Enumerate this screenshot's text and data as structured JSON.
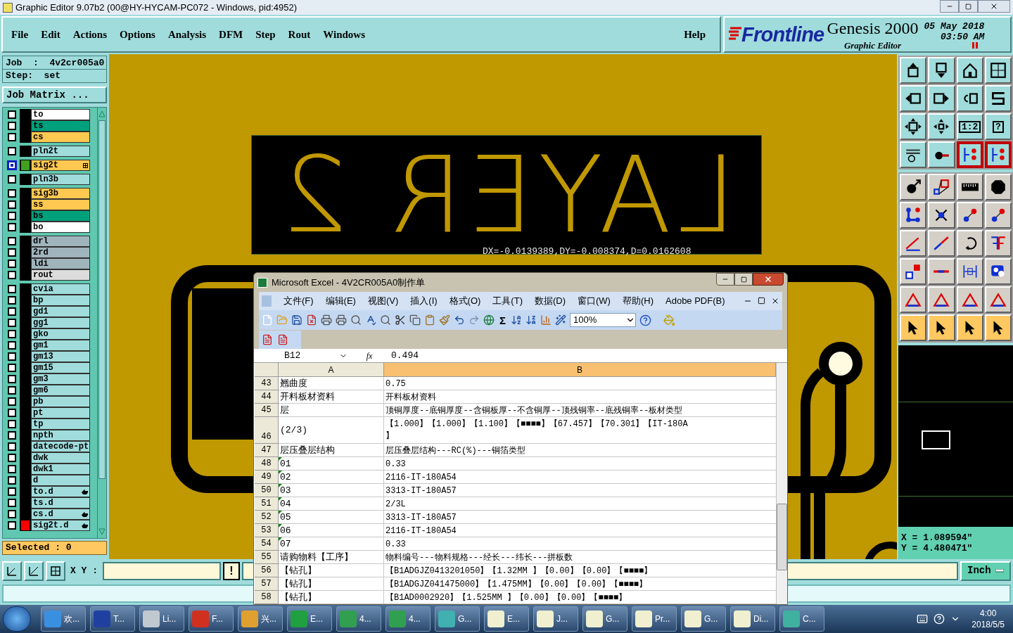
{
  "window": {
    "title": "Graphic Editor 9.07b2 (00@HY-HYCAM-PC072 - Windows, pid:4952)"
  },
  "menu": [
    "File",
    "Edit",
    "Actions",
    "Options",
    "Analysis",
    "DFM",
    "Step",
    "Rout",
    "Windows"
  ],
  "help": "Help",
  "brand": {
    "logo": "Frontline",
    "product": "Genesis 2000",
    "subtitle": "Graphic Editor",
    "date": "05 May 2018",
    "time": "03:50 AM"
  },
  "job": {
    "job": "Job  :  4v2cr005a0",
    "step": "Step:  set",
    "matrix_button": "Job Matrix ..."
  },
  "layer_groups": [
    [
      {
        "name": "to",
        "color": "#ffffff",
        "selected": false
      },
      {
        "name": "ts",
        "color": "#00a07c",
        "selected": false
      },
      {
        "name": "cs",
        "color": "#ffc850",
        "selected": false
      }
    ],
    [
      {
        "name": "pln2t",
        "color": "#a0dcdc",
        "selected": false
      }
    ],
    [
      {
        "name": "sig2t",
        "color": "#ffc850",
        "selected": true,
        "marker": {
          "color": "#40a020"
        },
        "expandable": true
      }
    ],
    [
      {
        "name": "pln3b",
        "color": "#a0dcdc",
        "selected": false
      }
    ],
    [
      {
        "name": "sig3b",
        "color": "#ffc850",
        "selected": false
      },
      {
        "name": "ss",
        "color": "#ffc850",
        "selected": false
      },
      {
        "name": "bs",
        "color": "#00a07c",
        "selected": false
      },
      {
        "name": "bo",
        "color": "#ffffff",
        "selected": false
      }
    ],
    [
      {
        "name": "drl",
        "color": "#a0b4bc",
        "selected": false
      },
      {
        "name": "2rd",
        "color": "#a0b4bc",
        "selected": false
      },
      {
        "name": "ldi",
        "color": "#a0b4bc",
        "selected": false
      },
      {
        "name": "rout",
        "color": "#dcdcdc",
        "selected": false
      }
    ],
    [
      {
        "name": "cvia",
        "color": "#a0dcdc",
        "selected": false
      },
      {
        "name": "bp",
        "color": "#a0dcdc",
        "selected": false
      },
      {
        "name": "gd1",
        "color": "#a0dcdc",
        "selected": false
      },
      {
        "name": "gg1",
        "color": "#a0dcdc",
        "selected": false
      },
      {
        "name": "gko",
        "color": "#a0dcdc",
        "selected": false
      },
      {
        "name": "gm1",
        "color": "#a0dcdc",
        "selected": false
      },
      {
        "name": "gm13",
        "color": "#a0dcdc",
        "selected": false
      },
      {
        "name": "gm15",
        "color": "#a0dcdc",
        "selected": false
      },
      {
        "name": "gm3",
        "color": "#a0dcdc",
        "selected": false
      },
      {
        "name": "gm6",
        "color": "#a0dcdc",
        "selected": false
      },
      {
        "name": "pb",
        "color": "#a0dcdc",
        "selected": false
      },
      {
        "name": "pt",
        "color": "#a0dcdc",
        "selected": false
      },
      {
        "name": "tp",
        "color": "#a0dcdc",
        "selected": false
      },
      {
        "name": "npth",
        "color": "#a0dcdc",
        "selected": false
      },
      {
        "name": "datecode-pt",
        "color": "#a0dcdc",
        "selected": false
      },
      {
        "name": "dwk",
        "color": "#a0dcdc",
        "selected": false
      },
      {
        "name": "dwk1",
        "color": "#a0dcdc",
        "selected": false
      },
      {
        "name": "d",
        "color": "#a0dcdc",
        "selected": false
      },
      {
        "name": "to.d",
        "color": "#a0dcdc",
        "selected": false,
        "has_pointer": true
      },
      {
        "name": "ts.d",
        "color": "#a0dcdc",
        "selected": false
      },
      {
        "name": "cs.d",
        "color": "#a0dcdc",
        "selected": false,
        "has_pointer": true
      },
      {
        "name": "sig2t.d",
        "color": "#a0dcdc",
        "selected": false,
        "marker": {
          "color": "#ff0000"
        },
        "has_pointer": true
      }
    ]
  ],
  "selected_count": "Selected : 0",
  "canvas": {
    "text": "LAYER 2",
    "measure": "DX=-0.0139389,DY=-0.008374,D=0.0162608"
  },
  "tools": [
    {
      "active": false
    },
    {
      "active": false
    },
    {
      "active": false
    },
    {
      "active": false
    },
    {
      "active": false
    },
    {
      "active": false
    },
    {
      "active": false
    },
    {
      "active": false
    },
    {
      "active": false
    },
    {
      "active": false
    },
    {
      "active": false,
      "label": "1:2"
    },
    {
      "active": false,
      "label": "?"
    },
    {
      "active": false
    },
    {
      "active": false
    },
    {
      "active": true
    },
    {
      "active": true
    },
    {
      "active": false
    },
    {
      "active": false
    },
    {
      "active": false
    },
    {
      "active": false
    },
    {
      "active": false
    },
    {
      "active": false
    },
    {
      "active": false
    },
    {
      "active": false
    },
    {
      "active": false
    },
    {
      "active": false
    },
    {
      "active": false
    },
    {
      "active": false
    },
    {
      "active": false
    },
    {
      "active": false
    },
    {
      "active": false
    },
    {
      "active": false
    },
    {
      "active": false
    },
    {
      "active": false
    },
    {
      "active": false
    },
    {
      "active": false
    },
    {
      "active": false
    },
    {
      "active": false
    },
    {
      "active": false
    },
    {
      "active": false
    }
  ],
  "coordinates": {
    "x": "X = 1.089594\"",
    "y": "Y = 4.480471\""
  },
  "bottom": {
    "xy_label": "X Y :",
    "bang": "!",
    "units": "Inch"
  },
  "excel": {
    "title": "Microsoft Excel - 4V2CR005A0制作单",
    "menu": [
      "文件(F)",
      "编辑(E)",
      "视图(V)",
      "插入(I)",
      "格式(O)",
      "工具(T)",
      "数据(D)",
      "窗口(W)",
      "帮助(H)",
      "Adobe PDF(B)"
    ],
    "sum": "Σ",
    "zoom": "100%",
    "name_box": "B12",
    "formula_label": "fx",
    "formula": "0.494",
    "columns": [
      {
        "label": "A",
        "selected": false
      },
      {
        "label": "B",
        "selected": true
      }
    ],
    "rows": [
      {
        "number": "43",
        "a": "翘曲度",
        "b": "0.75",
        "flag": false
      },
      {
        "number": "44",
        "a": "开料板材资料",
        "b": "开料板材资料",
        "flag": false
      },
      {
        "number": "45",
        "a": "层",
        "b": "顶铜厚度--底铜厚度--含铜板厚--不含铜厚--顶残铜率--底残铜率--板材类型",
        "flag": false
      },
      {
        "number": "46",
        "a": "(2/3)",
        "b": "【1.000】【1.000】【1.100】【■■■■】【67.457】【70.301】【IT-180A\n】",
        "flag": false
      },
      {
        "number": "47",
        "a": "层压叠层结构",
        "b": "层压叠层结构---RC(%)---铜箔类型",
        "flag": false
      },
      {
        "number": "48",
        "a": "01",
        "b": "0.33",
        "flag": true
      },
      {
        "number": "49",
        "a": "02",
        "b": "2116-IT-180A54",
        "flag": true
      },
      {
        "number": "50",
        "a": "03",
        "b": "3313-IT-180A57",
        "flag": true
      },
      {
        "number": "51",
        "a": "04",
        "b": "2/3L",
        "flag": true
      },
      {
        "number": "52",
        "a": "05",
        "b": "3313-IT-180A57",
        "flag": true
      },
      {
        "number": "53",
        "a": "06",
        "b": "2116-IT-180A54",
        "flag": true
      },
      {
        "number": "54",
        "a": "07",
        "b": "0.33",
        "flag": true
      },
      {
        "number": "55",
        "a": "请购物料【工序】",
        "b": "物料编号---物料规格---经长---纬长---拼板数",
        "flag": false
      },
      {
        "number": "56",
        "a": "【钻孔】",
        "b": "【B1ADGJZ0413201050】【1.32MM 】【0.00】【0.00】【■■■■】",
        "flag": false
      },
      {
        "number": "57",
        "a": "【钻孔】",
        "b": "【B1ADGJZ041475000】【1.475MM】【0.00】【0.00】【■■■■】",
        "flag": false
      },
      {
        "number": "58",
        "a": "【钻孔】",
        "b": "【B1AD0002920】【1.525MM 】【0.00】【0.00】【■■■■】",
        "flag": false
      }
    ]
  },
  "taskbar": {
    "items": [
      {
        "label": "欢..."
      },
      {
        "label": "T..."
      },
      {
        "label": "Li..."
      },
      {
        "label": "F..."
      },
      {
        "label": "兴..."
      },
      {
        "label": "E..."
      },
      {
        "label": "4..."
      },
      {
        "label": "4..."
      },
      {
        "label": "G..."
      },
      {
        "label": "E..."
      },
      {
        "label": "J..."
      },
      {
        "label": "G..."
      },
      {
        "label": "Pr..."
      },
      {
        "label": "G..."
      },
      {
        "label": "Di..."
      },
      {
        "label": "C..."
      }
    ],
    "time": "4:00",
    "date": "2018/5/5"
  }
}
